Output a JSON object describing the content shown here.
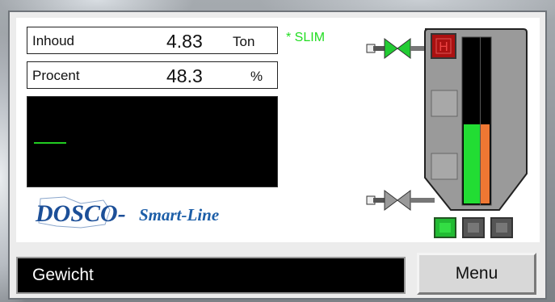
{
  "readout": {
    "inhoud": {
      "label": "Inhoud",
      "value": "4.83",
      "unit": "Ton"
    },
    "procent": {
      "label": "Procent",
      "value": "48.3",
      "unit": "%"
    }
  },
  "status": {
    "slim": "* SLIM"
  },
  "logo": {
    "brand": "DOSCO-",
    "product": "Smart-Line"
  },
  "silo": {
    "alarm_label": "H",
    "level_fraction_left": 0.48,
    "level_fraction_right": 0.48,
    "inlet_valve_state": "open",
    "outlet_valve_state": "closed",
    "indicators": [
      "active",
      "inactive",
      "inactive"
    ]
  },
  "footer": {
    "status_text": "Gewicht",
    "menu_label": "Menu"
  },
  "colors": {
    "level_green": "#22dd33",
    "level_orange": "#ee7733",
    "alarm": "#aa1111"
  }
}
